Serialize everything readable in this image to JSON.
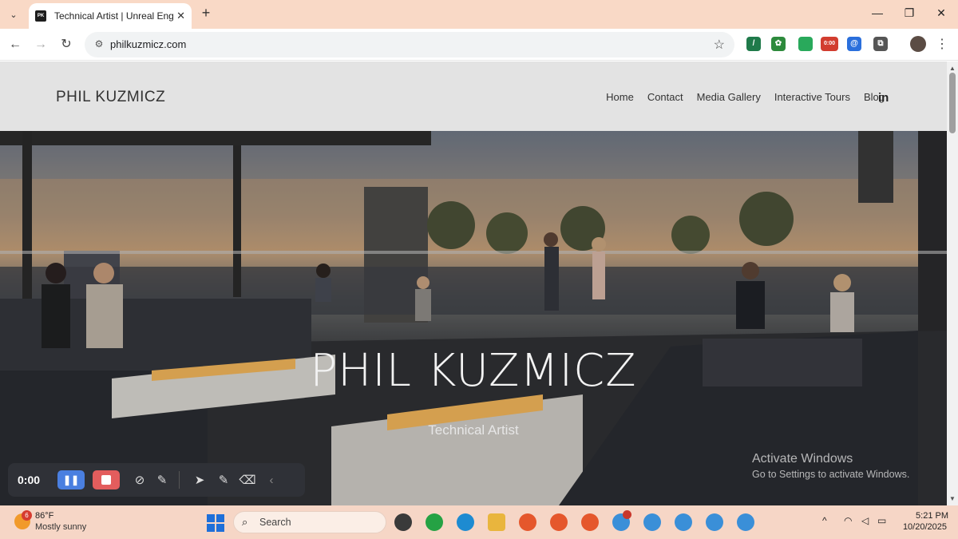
{
  "browser": {
    "tab": {
      "favicon_text": "PK",
      "title": "Technical Artist | Unreal Engine",
      "close": "✕"
    },
    "new_tab": "+",
    "window_controls": {
      "minimize": "—",
      "maximize": "❐",
      "close": "✕"
    },
    "nav": {
      "back": "←",
      "forward": "→",
      "reload": "↻"
    },
    "address": {
      "url": "philkuzmicz.com"
    },
    "extensions": [
      {
        "name": "ext-icon-1",
        "label": "/",
        "color": "#1f7a4a"
      },
      {
        "name": "ext-icon-2",
        "label": "✿",
        "color": "#2d8a3c"
      },
      {
        "name": "ext-icon-3",
        "label": "",
        "color": "#29a95b"
      },
      {
        "name": "ext-icon-4",
        "label": "0:00",
        "color": "#d23d2f"
      },
      {
        "name": "ext-icon-5",
        "label": "@",
        "color": "#2a6fdc"
      },
      {
        "name": "ext-icon-6",
        "label": "⧉",
        "color": "#555555"
      }
    ]
  },
  "site": {
    "brand": "PHIL KUZMICZ",
    "nav": [
      "Home",
      "Contact",
      "Media Gallery",
      "Interactive Tours",
      "Blog"
    ],
    "linkedin": "in",
    "hero": {
      "title": "PHIL KUZMICZ",
      "subtitle": "Technical Artist"
    }
  },
  "watermark": {
    "line1": "Activate Windows",
    "line2": "Go to Settings to activate Windows."
  },
  "recorder": {
    "time": "0:00",
    "pause": "❚❚"
  },
  "taskbar": {
    "weather": {
      "badge": "6",
      "temp": "86°F",
      "desc": "Mostly sunny"
    },
    "search": {
      "placeholder": "Search"
    },
    "clock": {
      "time": "5:21 PM",
      "date": "10/20/2025"
    },
    "apps": [
      {
        "name": "file-explorer-icon",
        "color": "#3a3a3a"
      },
      {
        "name": "whatsapp-icon",
        "color": "#25a244"
      },
      {
        "name": "edge-icon",
        "color": "#1e8bd1"
      },
      {
        "name": "folder-icon",
        "color": "#e9b53d"
      },
      {
        "name": "brave-icon-1",
        "color": "#e5572c"
      },
      {
        "name": "brave-icon-2",
        "color": "#e5572c"
      },
      {
        "name": "brave-icon-3",
        "color": "#e5572c"
      },
      {
        "name": "chrome-icon-1",
        "color": "#3a8fd8"
      },
      {
        "name": "chrome-icon-2",
        "color": "#3a8fd8"
      },
      {
        "name": "chrome-icon-3",
        "color": "#3a8fd8"
      },
      {
        "name": "chrome-icon-4",
        "color": "#3a8fd8"
      },
      {
        "name": "chrome-icon-5",
        "color": "#3a8fd8"
      }
    ]
  }
}
